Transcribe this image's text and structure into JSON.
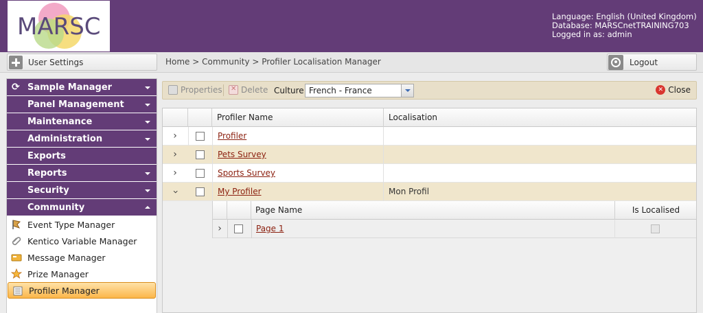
{
  "header": {
    "logo_text": "MARSC",
    "language": "Language: English (United Kingdom)",
    "database": "Database: MARSCnetTRAINING703",
    "logged_in": "Logged in as: admin"
  },
  "topbar": {
    "user_settings": "User Settings",
    "breadcrumb": "Home > Community > Profiler Localisation Manager",
    "logout": "Logout"
  },
  "sidebar": {
    "menus": [
      {
        "label": "Sample Manager",
        "caret": "down"
      },
      {
        "label": "Panel Management",
        "caret": "down"
      },
      {
        "label": "Maintenance",
        "caret": "down"
      },
      {
        "label": "Administration",
        "caret": "down"
      },
      {
        "label": "Exports",
        "caret": "none"
      },
      {
        "label": "Reports",
        "caret": "down"
      },
      {
        "label": "Security",
        "caret": "down"
      },
      {
        "label": "Community",
        "caret": "up"
      }
    ],
    "community_items": [
      {
        "label": "Event Type Manager",
        "icon": "flag-icon"
      },
      {
        "label": "Kentico Variable Manager",
        "icon": "paperclip-icon"
      },
      {
        "label": "Message Manager",
        "icon": "message-icon"
      },
      {
        "label": "Prize Manager",
        "icon": "star-medal-icon"
      },
      {
        "label": "Profiler Manager",
        "icon": "list-icon",
        "active": true
      }
    ]
  },
  "toolbar": {
    "properties": "Properties",
    "delete": "Delete",
    "culture_label": "Culture",
    "culture_value": "French - France",
    "close": "Close"
  },
  "grid": {
    "columns": [
      "Profiler Name",
      "Localisation"
    ],
    "rows": [
      {
        "name": "Profiler",
        "localisation": "",
        "expanded": false
      },
      {
        "name": "Pets Survey",
        "localisation": "",
        "expanded": false
      },
      {
        "name": "Sports Survey",
        "localisation": "",
        "expanded": false
      },
      {
        "name": "My Profiler",
        "localisation": "Mon Profil",
        "expanded": true
      }
    ],
    "subgrid": {
      "columns": [
        "Page Name",
        "Is Localised"
      ],
      "rows": [
        {
          "name": "Page 1",
          "is_localised": false
        }
      ]
    }
  },
  "colors": {
    "brand_purple": "#633c77",
    "accent_orange": "#fbb64a",
    "row_alt": "#f0e6cc",
    "link": "#8b1f0e"
  }
}
